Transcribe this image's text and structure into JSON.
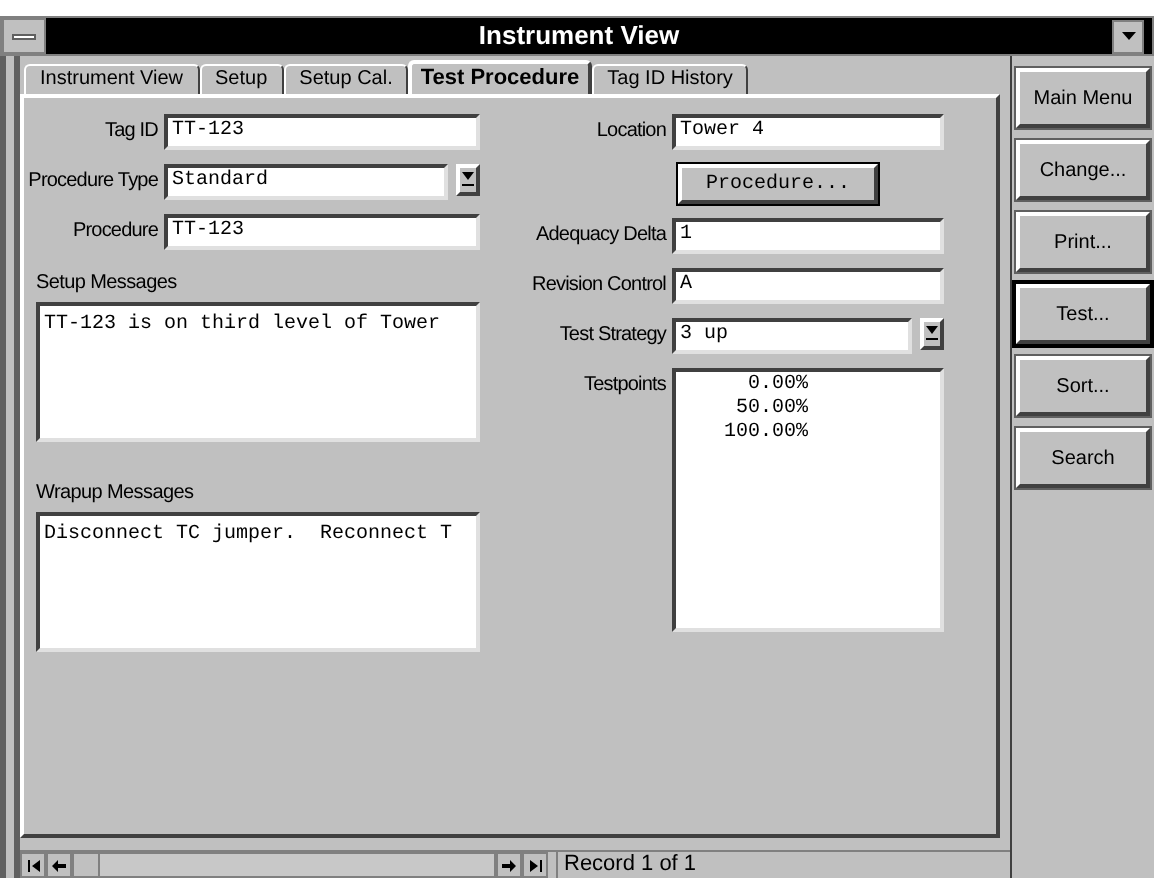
{
  "window": {
    "title": "Instrument View"
  },
  "tabs": [
    {
      "label": "Instrument View",
      "selected": false
    },
    {
      "label": "Setup",
      "selected": false
    },
    {
      "label": "Setup Cal.",
      "selected": false
    },
    {
      "label": "Test Procedure",
      "selected": true
    },
    {
      "label": "Tag ID History",
      "selected": false
    }
  ],
  "left_fields": [
    {
      "kind": "text",
      "label": "Tag ID",
      "value": "TT-123"
    },
    {
      "kind": "dropdown",
      "label": "Procedure Type",
      "value": "Standard"
    },
    {
      "kind": "text",
      "label": "Procedure",
      "value": "TT-123"
    }
  ],
  "setup_messages": {
    "label": "Setup Messages",
    "value": "TT-123 is on third level of Tower"
  },
  "wrapup_messages": {
    "label": "Wrapup Messages",
    "value": "Disconnect TC jumper.  Reconnect T"
  },
  "right_fields": [
    {
      "kind": "text",
      "label": "Location",
      "value": "Tower 4"
    },
    {
      "kind": "button",
      "label": "Procedure..."
    },
    {
      "kind": "text",
      "label": "Adequacy Delta",
      "value": "1"
    },
    {
      "kind": "text",
      "label": "Revision Control",
      "value": "A"
    },
    {
      "kind": "dropdown",
      "label": "Test Strategy",
      "value": "3 up"
    },
    {
      "kind": "list",
      "label": "Testpoints",
      "items": [
        "0.00%",
        "50.00%",
        "100.00%"
      ]
    }
  ],
  "side_buttons": [
    {
      "label": "Main Menu",
      "selected": false
    },
    {
      "label": "Change...",
      "selected": false
    },
    {
      "label": "Print...",
      "selected": false
    },
    {
      "label": "Test...",
      "selected": true
    },
    {
      "label": "Sort...",
      "selected": false
    },
    {
      "label": "Search",
      "selected": false
    }
  ],
  "status_bar": {
    "record": "Record 1 of 1"
  }
}
